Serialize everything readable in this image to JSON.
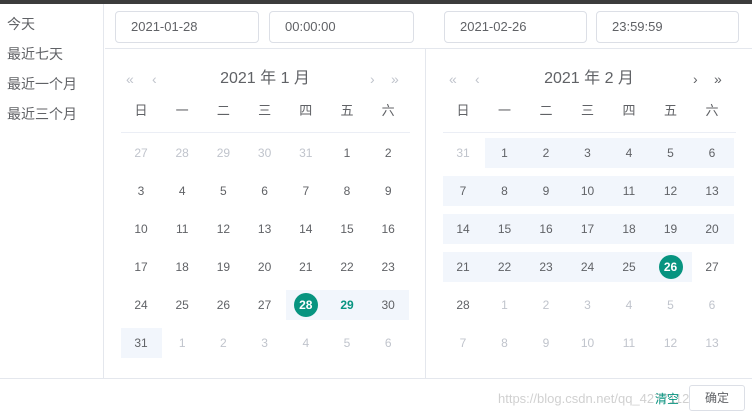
{
  "sidebar": {
    "items": [
      {
        "label": "今天"
      },
      {
        "label": "最近七天"
      },
      {
        "label": "最近一个月"
      },
      {
        "label": "最近三个月"
      }
    ]
  },
  "header": {
    "start_date": "2021-01-28",
    "start_time": "00:00:00",
    "end_date": "2021-02-26",
    "end_time": "23:59:59"
  },
  "calendars": [
    {
      "title": "2021 年 1 月",
      "weekdays": [
        "日",
        "一",
        "二",
        "三",
        "四",
        "五",
        "六"
      ],
      "rows": [
        [
          {
            "d": "27",
            "t": "other"
          },
          {
            "d": "28",
            "t": "other"
          },
          {
            "d": "29",
            "t": "other"
          },
          {
            "d": "30",
            "t": "other"
          },
          {
            "d": "31",
            "t": "other"
          },
          {
            "d": "1",
            "t": ""
          },
          {
            "d": "2",
            "t": ""
          }
        ],
        [
          {
            "d": "3",
            "t": ""
          },
          {
            "d": "4",
            "t": ""
          },
          {
            "d": "5",
            "t": ""
          },
          {
            "d": "6",
            "t": ""
          },
          {
            "d": "7",
            "t": ""
          },
          {
            "d": "8",
            "t": ""
          },
          {
            "d": "9",
            "t": ""
          }
        ],
        [
          {
            "d": "10",
            "t": ""
          },
          {
            "d": "11",
            "t": ""
          },
          {
            "d": "12",
            "t": ""
          },
          {
            "d": "13",
            "t": ""
          },
          {
            "d": "14",
            "t": ""
          },
          {
            "d": "15",
            "t": ""
          },
          {
            "d": "16",
            "t": ""
          }
        ],
        [
          {
            "d": "17",
            "t": ""
          },
          {
            "d": "18",
            "t": ""
          },
          {
            "d": "19",
            "t": ""
          },
          {
            "d": "20",
            "t": ""
          },
          {
            "d": "21",
            "t": ""
          },
          {
            "d": "22",
            "t": ""
          },
          {
            "d": "23",
            "t": ""
          }
        ],
        [
          {
            "d": "24",
            "t": ""
          },
          {
            "d": "25",
            "t": ""
          },
          {
            "d": "26",
            "t": ""
          },
          {
            "d": "27",
            "t": ""
          },
          {
            "d": "28",
            "t": "sel"
          },
          {
            "d": "29",
            "t": "today"
          },
          {
            "d": "30",
            "t": ""
          }
        ],
        [
          {
            "d": "31",
            "t": ""
          },
          {
            "d": "1",
            "t": "other"
          },
          {
            "d": "2",
            "t": "other"
          },
          {
            "d": "3",
            "t": "other"
          },
          {
            "d": "4",
            "t": "other"
          },
          {
            "d": "5",
            "t": "other"
          },
          {
            "d": "6",
            "t": "other"
          }
        ]
      ],
      "in_range": [
        [
          4,
          4,
          6
        ],
        [
          5,
          0,
          0
        ]
      ]
    },
    {
      "title": "2021 年 2 月",
      "weekdays": [
        "日",
        "一",
        "二",
        "三",
        "四",
        "五",
        "六"
      ],
      "rows": [
        [
          {
            "d": "31",
            "t": "other"
          },
          {
            "d": "1",
            "t": ""
          },
          {
            "d": "2",
            "t": ""
          },
          {
            "d": "3",
            "t": ""
          },
          {
            "d": "4",
            "t": ""
          },
          {
            "d": "5",
            "t": ""
          },
          {
            "d": "6",
            "t": ""
          }
        ],
        [
          {
            "d": "7",
            "t": ""
          },
          {
            "d": "8",
            "t": ""
          },
          {
            "d": "9",
            "t": ""
          },
          {
            "d": "10",
            "t": ""
          },
          {
            "d": "11",
            "t": ""
          },
          {
            "d": "12",
            "t": ""
          },
          {
            "d": "13",
            "t": ""
          }
        ],
        [
          {
            "d": "14",
            "t": ""
          },
          {
            "d": "15",
            "t": ""
          },
          {
            "d": "16",
            "t": ""
          },
          {
            "d": "17",
            "t": ""
          },
          {
            "d": "18",
            "t": ""
          },
          {
            "d": "19",
            "t": ""
          },
          {
            "d": "20",
            "t": ""
          }
        ],
        [
          {
            "d": "21",
            "t": ""
          },
          {
            "d": "22",
            "t": ""
          },
          {
            "d": "23",
            "t": ""
          },
          {
            "d": "24",
            "t": ""
          },
          {
            "d": "25",
            "t": ""
          },
          {
            "d": "26",
            "t": "sel"
          },
          {
            "d": "27",
            "t": ""
          }
        ],
        [
          {
            "d": "28",
            "t": ""
          },
          {
            "d": "1",
            "t": "other"
          },
          {
            "d": "2",
            "t": "other"
          },
          {
            "d": "3",
            "t": "other"
          },
          {
            "d": "4",
            "t": "other"
          },
          {
            "d": "5",
            "t": "other"
          },
          {
            "d": "6",
            "t": "other"
          }
        ],
        [
          {
            "d": "7",
            "t": "other"
          },
          {
            "d": "8",
            "t": "other"
          },
          {
            "d": "9",
            "t": "other"
          },
          {
            "d": "10",
            "t": "other"
          },
          {
            "d": "11",
            "t": "other"
          },
          {
            "d": "12",
            "t": "other"
          },
          {
            "d": "13",
            "t": "other"
          }
        ]
      ],
      "in_range": [
        [
          0,
          1,
          6
        ],
        [
          1,
          0,
          6
        ],
        [
          2,
          0,
          6
        ],
        [
          3,
          0,
          5
        ]
      ]
    }
  ],
  "footer": {
    "clear_label": "清空",
    "confirm_label": "确定",
    "watermark": "https://blog.csdn.net/qq_42771129"
  },
  "colors": {
    "accent": "#079480",
    "range_bg": "#f2f6fc",
    "border": "#e4e7ed"
  },
  "icons": {
    "prev_year": "double-chevron-left-icon",
    "prev_month": "chevron-left-icon",
    "next_month": "chevron-right-icon",
    "next_year": "double-chevron-right-icon",
    "range_separator": "chevron-right-icon"
  }
}
